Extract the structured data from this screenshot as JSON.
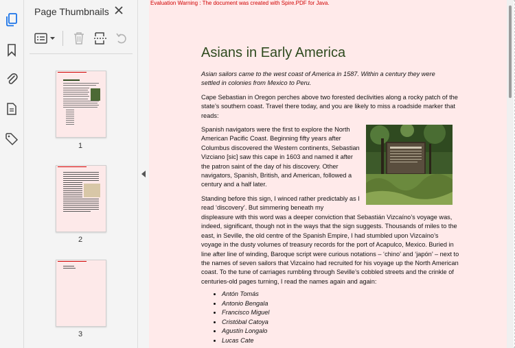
{
  "sidebar": {
    "icons": [
      "pages-icon",
      "bookmark-icon",
      "attachment-icon",
      "document-properties-icon",
      "tag-icon"
    ]
  },
  "panel": {
    "title": "Page Thumbnails",
    "thumbnails": [
      {
        "page": "1"
      },
      {
        "page": "2"
      },
      {
        "page": "3"
      }
    ]
  },
  "document": {
    "warning": "Evaluation Warning : The document was created with Spire.PDF for Java.",
    "title": "Asians in Early America",
    "intro": "Asian sailors came to the west coast of America in 1587. Within a century they were settled in colonies from Mexico to Peru.",
    "para1": "Cape Sebastian in Oregon perches above two forested declivities along a rocky patch of the state’s southern coast. Travel there today, and you are likely to miss a roadside marker that reads:",
    "para2": "Spanish navigators were the first to explore the North American Pacific Coast. Beginning fifty years after Columbus discovered the Western continents, Sebastian Vizciano [sic] saw this cape in 1603 and named it after the patron saint of the day of his discovery. Other navigators, Spanish, British, and American, followed a century and a half later.",
    "para3_a": "Standing before this sign, I winced rather predictably as I read ‘discovery’. But simmering beneath my",
    "para3_b": "displeasure with this word was a deeper conviction that Sebastián Vizcaíno’s voyage was, indeed, significant, though not in the ways that the sign suggests. Thousands of miles to the east, in Seville, the old centre of the Spanish Empire, I had stumbled upon Vizcaíno’s voyage in the dusty volumes of treasury records for the port of Acapulco, Mexico. Buried in line after line of winding, Baroque script were curious notations – ‘chino’ and ‘japón’ – next to the names of seven sailors that Vizcaíno had recruited for his voyage up the North American coast. To the tune of carriages rumbling through Seville’s cobbled streets and the crinkle of centuries-old pages turning, I read the names again and again:",
    "names": [
      "Antón Tomás",
      "Antonio Bengala",
      "Francisco Miguel",
      "Cristóbal Catoya",
      "Agustín Longalo",
      "Lucas Cate"
    ]
  },
  "colors": {
    "page_background": "#ffeaea",
    "title": "#2e4a1e",
    "warning": "#d00000",
    "accent": "#1a73e8"
  }
}
